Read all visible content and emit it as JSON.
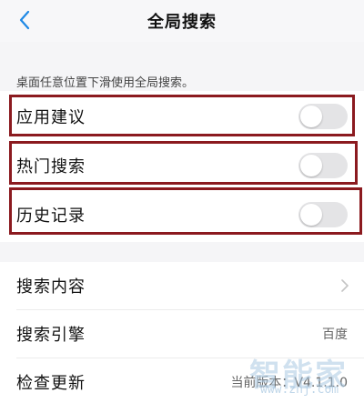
{
  "header": {
    "title": "全局搜索"
  },
  "hint": "桌面任意位置下滑使用全局搜索。",
  "toggles": [
    {
      "label": "应用建议",
      "on": false
    },
    {
      "label": "热门搜索",
      "on": false
    },
    {
      "label": "历史记录",
      "on": false
    }
  ],
  "menu": [
    {
      "label": "搜索内容",
      "value": ""
    },
    {
      "label": "搜索引擎",
      "value": "百度"
    },
    {
      "label": "检查更新",
      "value": "当前版本：V4.1.1.0"
    }
  ],
  "watermark": {
    "text": "智能家",
    "sub": "www.znj.com"
  },
  "colors": {
    "highlight": "#8b1a1f",
    "accent": "#1e88e5",
    "toggle_off": "#e4e4e6"
  }
}
